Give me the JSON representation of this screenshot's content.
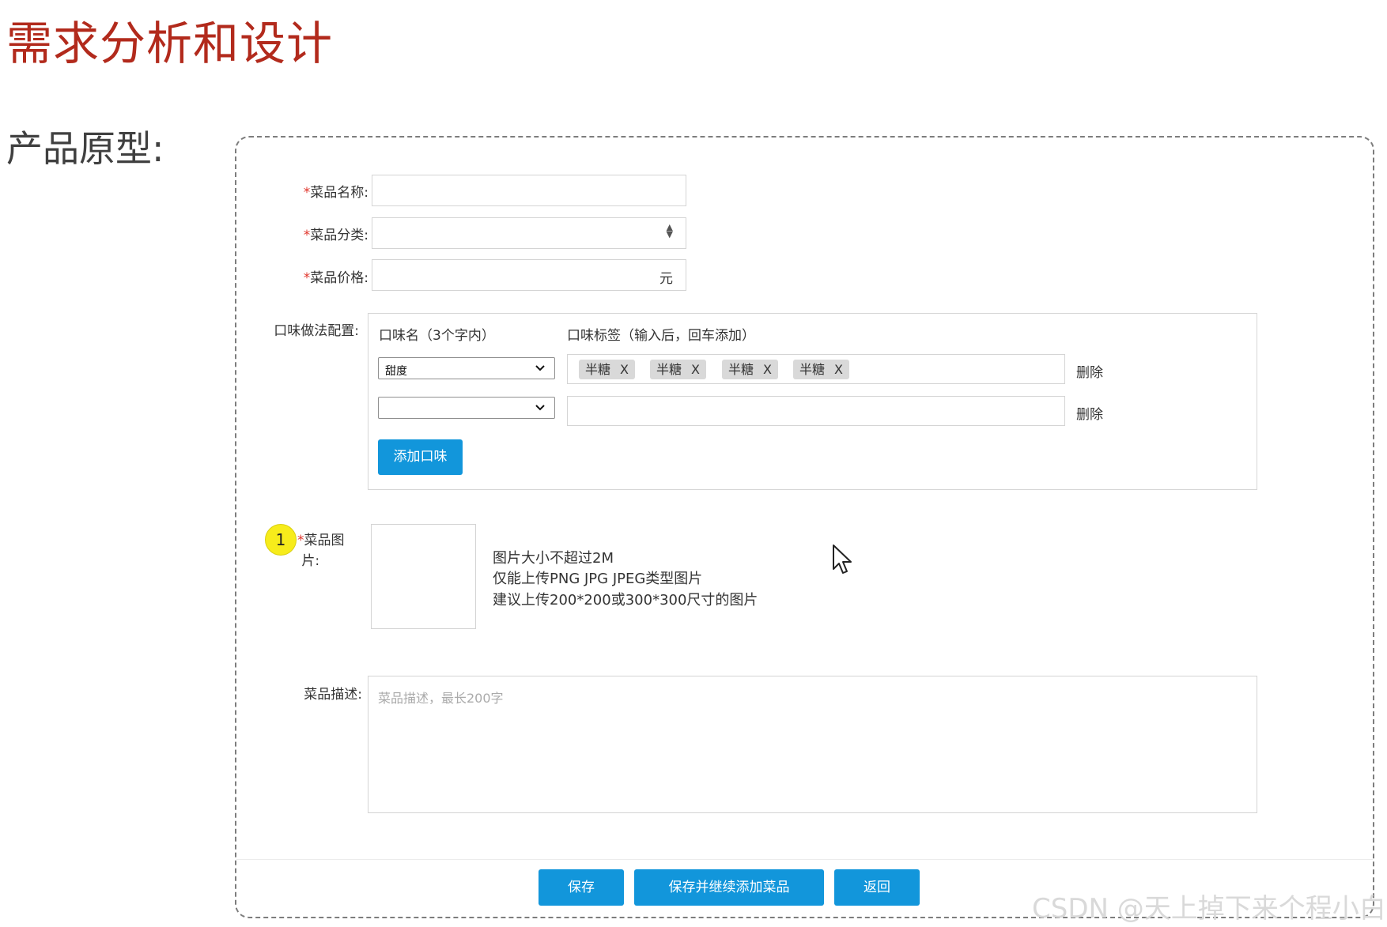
{
  "slide": {
    "title": "需求分析和设计",
    "section_label": "产品原型:"
  },
  "form": {
    "required_mark": "*",
    "dish_name": {
      "label": "菜品名称:",
      "value": ""
    },
    "dish_category": {
      "label": "菜品分类:",
      "value": ""
    },
    "dish_price": {
      "label": "菜品价格:",
      "value": "",
      "suffix": "元"
    },
    "flavor": {
      "label": "口味做法配置:",
      "name_header": "口味名（3个字内）",
      "tags_header": "口味标签（输入后，回车添加）",
      "rows": [
        {
          "name": "甜度",
          "tags": [
            "半糖",
            "半糖",
            "半糖",
            "半糖"
          ],
          "delete_label": "删除"
        },
        {
          "name": "",
          "tags": [],
          "delete_label": "删除"
        }
      ],
      "tag_remove": "X",
      "add_button": "添加口味"
    },
    "dish_image": {
      "badge": "1",
      "label_line1": "菜品图",
      "label_line2": "片:",
      "hints": [
        "图片大小不超过2M",
        "仅能上传PNG JPG JPEG类型图片",
        "建议上传200*200或300*300尺寸的图片"
      ]
    },
    "description": {
      "label": "菜品描述:",
      "placeholder": "菜品描述，最长200字"
    }
  },
  "footer": {
    "save": "保存",
    "save_continue": "保存并继续添加菜品",
    "back": "返回"
  },
  "watermark": "CSDN @天上掉下来个程小白",
  "colors": {
    "title": "#b22a1c",
    "primary_button": "#1296db",
    "required": "#e0352b",
    "badge": "#f7ec1b"
  }
}
